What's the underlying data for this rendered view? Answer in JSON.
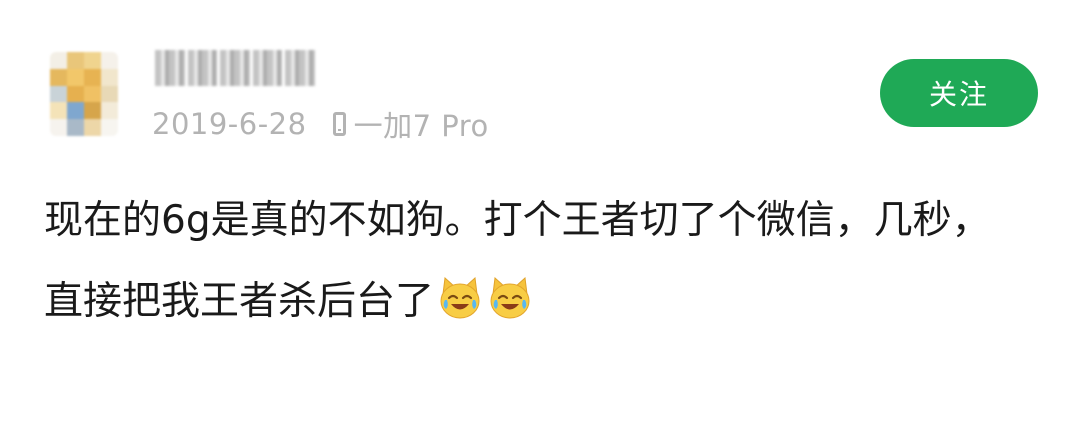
{
  "post": {
    "date": "2019-6-28",
    "device": "一加7 Pro",
    "follow_label": "关注",
    "content_line1": "现在的6g是真的不如狗。打个王者切了个微信，几秒，",
    "content_line2": "直接把我王者杀后台了",
    "emojis": [
      "crying-laughing-cat-emoji",
      "crying-laughing-cat-emoji"
    ]
  },
  "colors": {
    "follow_button": "#1fa956",
    "meta_text": "#b3b3b3",
    "body_text": "#1a1a1a"
  }
}
